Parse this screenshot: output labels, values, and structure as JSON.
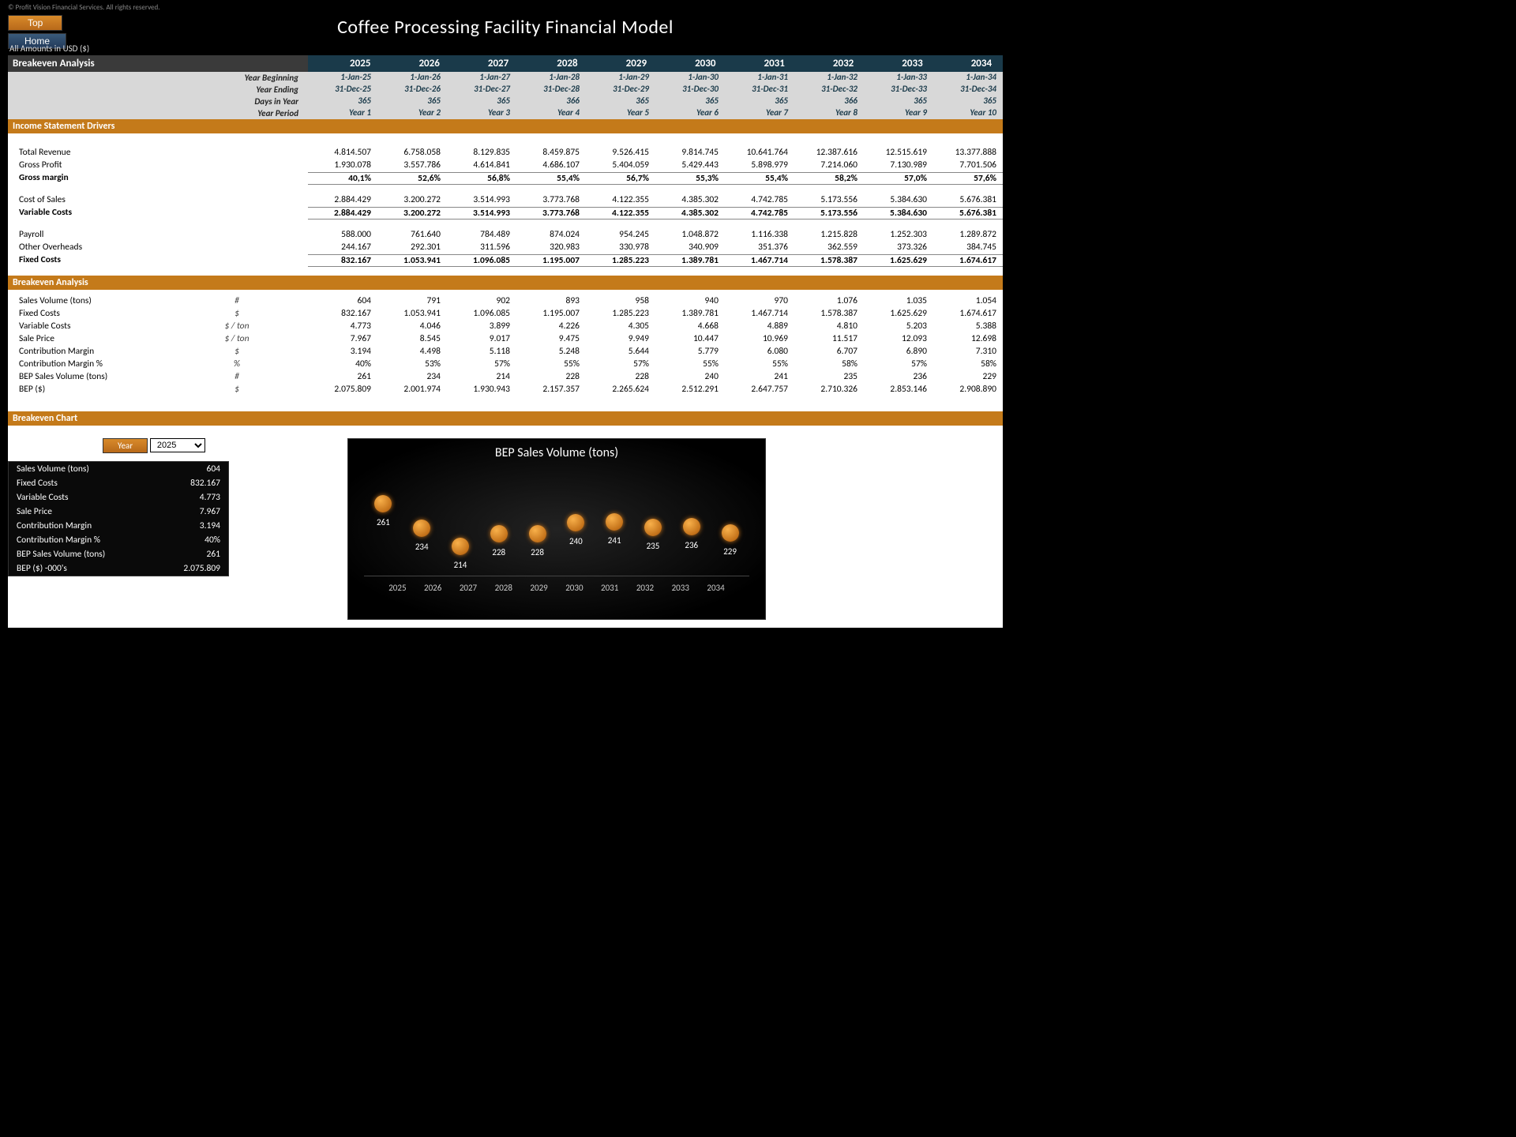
{
  "copyright": "© Profit Vision Financial Services. All rights reserved.",
  "buttons": {
    "top": "Top",
    "home": "Home",
    "year": "Year"
  },
  "title": "Coffee Processing Facility Financial Model",
  "currency_note": "All Amounts in  USD ($)",
  "sections": {
    "breakeven": "Breakeven Analysis",
    "income_drivers": "Income Statement Drivers",
    "breakeven2": "Breakeven Analysis",
    "chart": "Breakeven Chart"
  },
  "years": [
    "2025",
    "2026",
    "2027",
    "2028",
    "2029",
    "2030",
    "2031",
    "2032",
    "2033",
    "2034"
  ],
  "meta": {
    "year_beginning": {
      "label": "Year Beginning",
      "vals": [
        "1-Jan-25",
        "1-Jan-26",
        "1-Jan-27",
        "1-Jan-28",
        "1-Jan-29",
        "1-Jan-30",
        "1-Jan-31",
        "1-Jan-32",
        "1-Jan-33",
        "1-Jan-34"
      ]
    },
    "year_ending": {
      "label": "Year Ending",
      "vals": [
        "31-Dec-25",
        "31-Dec-26",
        "31-Dec-27",
        "31-Dec-28",
        "31-Dec-29",
        "31-Dec-30",
        "31-Dec-31",
        "31-Dec-32",
        "31-Dec-33",
        "31-Dec-34"
      ]
    },
    "days": {
      "label": "Days in Year",
      "vals": [
        "365",
        "365",
        "365",
        "366",
        "365",
        "365",
        "365",
        "366",
        "365",
        "365"
      ]
    },
    "period": {
      "label": "Year Period",
      "vals": [
        "Year 1",
        "Year 2",
        "Year 3",
        "Year 4",
        "Year 5",
        "Year 6",
        "Year 7",
        "Year 8",
        "Year 9",
        "Year 10"
      ]
    }
  },
  "income": {
    "total_revenue": {
      "label": "Total Revenue",
      "vals": [
        "4.814.507",
        "6.758.058",
        "8.129.835",
        "8.459.875",
        "9.526.415",
        "9.814.745",
        "10.641.764",
        "12.387.616",
        "12.515.619",
        "13.377.888"
      ]
    },
    "gross_profit": {
      "label": "Gross Profit",
      "vals": [
        "1.930.078",
        "3.557.786",
        "4.614.841",
        "4.686.107",
        "5.404.059",
        "5.429.443",
        "5.898.979",
        "7.214.060",
        "7.130.989",
        "7.701.506"
      ]
    },
    "gross_margin": {
      "label": "Gross margin",
      "vals": [
        "40,1%",
        "52,6%",
        "56,8%",
        "55,4%",
        "56,7%",
        "55,3%",
        "55,4%",
        "58,2%",
        "57,0%",
        "57,6%"
      ]
    },
    "cost_sales": {
      "label": "Cost of Sales",
      "vals": [
        "2.884.429",
        "3.200.272",
        "3.514.993",
        "3.773.768",
        "4.122.355",
        "4.385.302",
        "4.742.785",
        "5.173.556",
        "5.384.630",
        "5.676.381"
      ]
    },
    "variable_costs": {
      "label": "Variable Costs",
      "vals": [
        "2.884.429",
        "3.200.272",
        "3.514.993",
        "3.773.768",
        "4.122.355",
        "4.385.302",
        "4.742.785",
        "5.173.556",
        "5.384.630",
        "5.676.381"
      ]
    },
    "payroll": {
      "label": "Payroll",
      "vals": [
        "588.000",
        "761.640",
        "784.489",
        "874.024",
        "954.245",
        "1.048.872",
        "1.116.338",
        "1.215.828",
        "1.252.303",
        "1.289.872"
      ]
    },
    "overheads": {
      "label": "Other Overheads",
      "vals": [
        "244.167",
        "292.301",
        "311.596",
        "320.983",
        "330.978",
        "340.909",
        "351.376",
        "362.559",
        "373.326",
        "384.745"
      ]
    },
    "fixed_costs": {
      "label": "Fixed Costs",
      "vals": [
        "832.167",
        "1.053.941",
        "1.096.085",
        "1.195.007",
        "1.285.223",
        "1.389.781",
        "1.467.714",
        "1.578.387",
        "1.625.629",
        "1.674.617"
      ]
    }
  },
  "breakeven": {
    "sales_vol": {
      "label": "Sales Volume (tons)",
      "unit": "#",
      "vals": [
        "604",
        "791",
        "902",
        "893",
        "958",
        "940",
        "970",
        "1.076",
        "1.035",
        "1.054"
      ]
    },
    "fixed_costs": {
      "label": "Fixed Costs",
      "unit": "$",
      "vals": [
        "832.167",
        "1.053.941",
        "1.096.085",
        "1.195.007",
        "1.285.223",
        "1.389.781",
        "1.467.714",
        "1.578.387",
        "1.625.629",
        "1.674.617"
      ]
    },
    "var_costs": {
      "label": "Variable Costs",
      "unit": "$ / ton",
      "vals": [
        "4.773",
        "4.046",
        "3.899",
        "4.226",
        "4.305",
        "4.668",
        "4.889",
        "4.810",
        "5.203",
        "5.388"
      ]
    },
    "sale_price": {
      "label": "Sale Price",
      "unit": "$ / ton",
      "vals": [
        "7.967",
        "8.545",
        "9.017",
        "9.475",
        "9.949",
        "10.447",
        "10.969",
        "11.517",
        "12.093",
        "12.698"
      ]
    },
    "contrib": {
      "label": "Contribution Margin",
      "unit": "$",
      "vals": [
        "3.194",
        "4.498",
        "5.118",
        "5.248",
        "5.644",
        "5.779",
        "6.080",
        "6.707",
        "6.890",
        "7.310"
      ]
    },
    "contrib_pct": {
      "label": "Contribution Margin %",
      "unit": "%",
      "vals": [
        "40%",
        "53%",
        "57%",
        "55%",
        "57%",
        "55%",
        "55%",
        "58%",
        "57%",
        "58%"
      ]
    },
    "bep_vol": {
      "label": "BEP Sales Volume (tons)",
      "unit": "#",
      "vals": [
        "261",
        "234",
        "214",
        "228",
        "228",
        "240",
        "241",
        "235",
        "236",
        "229"
      ]
    },
    "bep_usd": {
      "label": "BEP ($)",
      "unit": "$",
      "vals": [
        "2.075.809",
        "2.001.974",
        "1.930.943",
        "2.157.357",
        "2.265.624",
        "2.512.291",
        "2.647.757",
        "2.710.326",
        "2.853.146",
        "2.908.890"
      ]
    }
  },
  "selected_year": "2025",
  "summary": {
    "rows": [
      {
        "label": "Sales Volume (tons)",
        "val": "604"
      },
      {
        "label": "Fixed Costs",
        "val": "832.167"
      },
      {
        "label": "Variable Costs",
        "val": "4.773"
      },
      {
        "label": "Sale Price",
        "val": "7.967"
      },
      {
        "label": "Contribution Margin",
        "val": "3.194"
      },
      {
        "label": "Contribution Margin %",
        "val": "40%"
      },
      {
        "label": "BEP Sales Volume (tons)",
        "val": "261"
      },
      {
        "label": "BEP ($) -000's",
        "val": "2.075.809"
      }
    ]
  },
  "chart_data": {
    "type": "scatter",
    "title": "BEP Sales Volume (tons)",
    "categories": [
      "2025",
      "2026",
      "2027",
      "2028",
      "2029",
      "2030",
      "2031",
      "2032",
      "2033",
      "2034"
    ],
    "values": [
      261,
      234,
      214,
      228,
      228,
      240,
      241,
      235,
      236,
      229
    ],
    "xlabel": "",
    "ylabel": "",
    "ylim": [
      200,
      270
    ]
  }
}
